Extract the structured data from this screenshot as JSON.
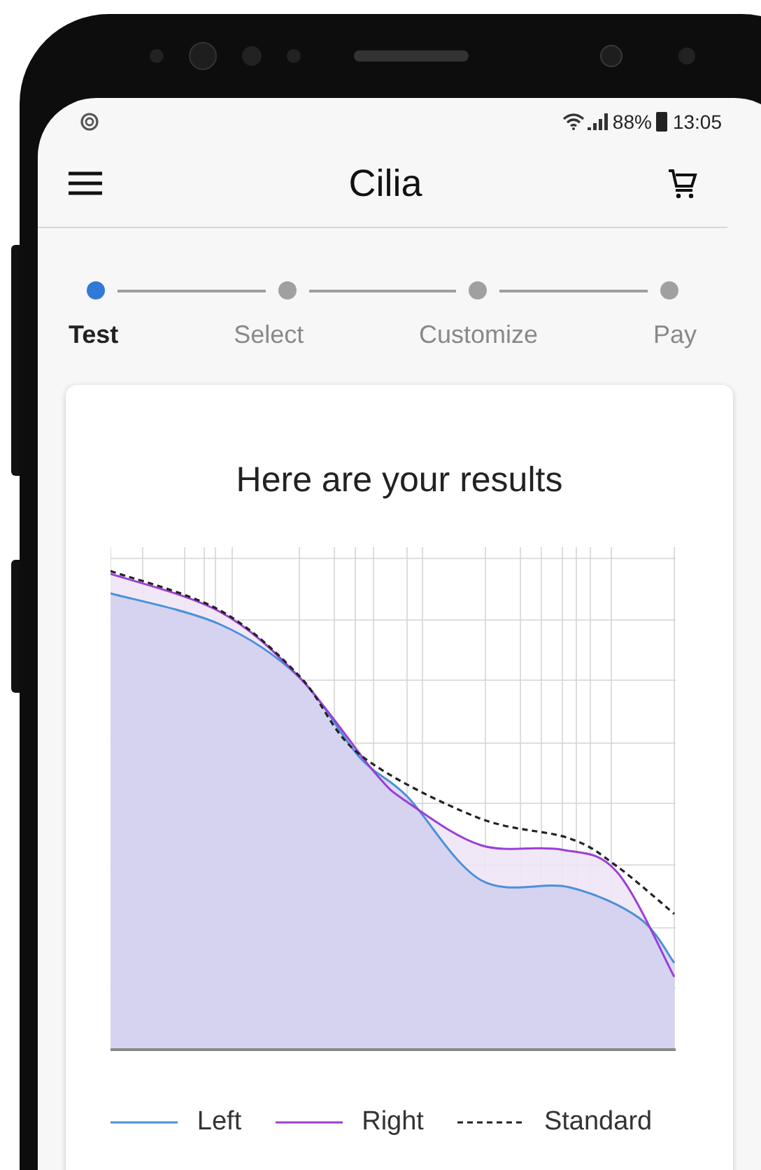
{
  "status_bar": {
    "battery": "88%",
    "time": "13:05"
  },
  "app_bar": {
    "title": "Cilia"
  },
  "stepper": [
    {
      "label": "Test",
      "selected": true
    },
    {
      "label": "Select",
      "selected": false
    },
    {
      "label": "Customize",
      "selected": false
    },
    {
      "label": "Pay",
      "selected": false
    }
  ],
  "card": {
    "title": "Here are your results",
    "legend": [
      {
        "label": "Left",
        "color": "#4a90d9",
        "kind": "solid"
      },
      {
        "label": "Right",
        "color": "#9b3fd6",
        "kind": "solid"
      },
      {
        "label": "Standard",
        "color": "#222222",
        "kind": "dashed"
      }
    ]
  }
}
